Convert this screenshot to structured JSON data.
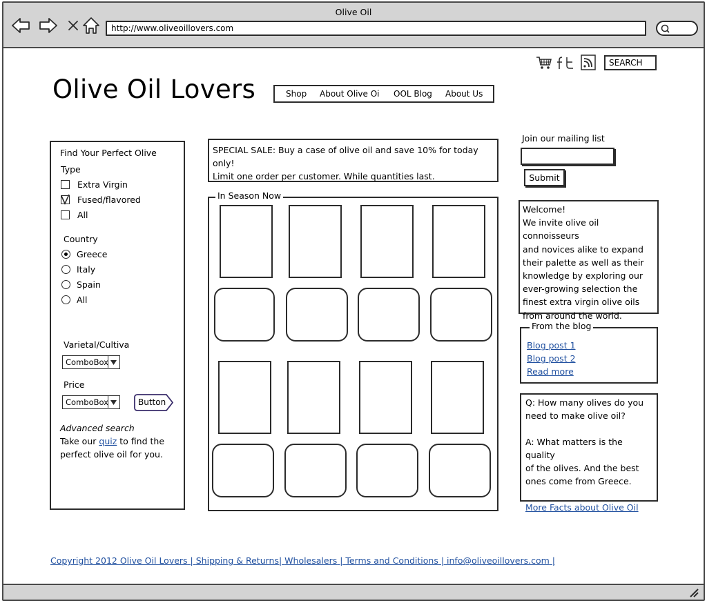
{
  "browser": {
    "window_title": "Olive Oil",
    "url": "http://www.oliveoillovers.com",
    "icons": [
      "back-arrow-icon",
      "forward-arrow-icon",
      "close-x-icon",
      "home-icon",
      "search-icon",
      "resize-grip-icon"
    ]
  },
  "header": {
    "site_title": "Olive Oil Lovers",
    "nav": [
      "Shop",
      "About Olive Oi",
      "OOL Blog",
      "About Us"
    ],
    "search_label": "SEARCH",
    "social_icons": [
      "cart-icon",
      "facebook-icon",
      "twitter-icon",
      "rss-icon"
    ]
  },
  "filters": {
    "title": "Find Your Perfect Olive",
    "type_label": "Type",
    "type_options": [
      {
        "label": "Extra Virgin",
        "checked": false
      },
      {
        "label": "Fused/flavored",
        "checked": true
      },
      {
        "label": "All",
        "checked": false
      }
    ],
    "country_label": "Country",
    "country_options": [
      {
        "label": "Greece",
        "selected": true
      },
      {
        "label": "Italy",
        "selected": false
      },
      {
        "label": "Spain",
        "selected": false
      },
      {
        "label": "All",
        "selected": false
      }
    ],
    "varietal_label": "Varietal/Cultiva",
    "varietal_combo": "ComboBox",
    "price_label": "Price",
    "price_combo": "ComboBox",
    "button_label": "Button",
    "advanced_title": "Advanced search",
    "advanced_prefix": "Take our",
    "advanced_link": "quiz",
    "advanced_suffix": "to find the",
    "advanced_line2": "perfect olive oil for you."
  },
  "sale": {
    "line1": "SPECIAL SALE: Buy a case of olive oil and save 10% for today only!",
    "line2": "Limit one order per customer. While quantities last."
  },
  "season": {
    "legend": "In Season Now"
  },
  "mailing": {
    "label": "Join our mailing list",
    "input_value": "",
    "submit_label": "Submit"
  },
  "welcome": {
    "lines": [
      "Welcome!",
      "We invite olive oil connoisseurs",
      "and novices alike to expand",
      "their palette as well as their",
      "knowledge by exploring our",
      "ever-growing selection the",
      "finest extra virgin olive oils",
      "from around the world."
    ]
  },
  "blog": {
    "legend": "From the blog",
    "links": [
      "Blog post 1",
      "Blog post 2",
      "Read more"
    ]
  },
  "faq": {
    "q_line1": "Q: How many olives do you",
    "q_line2": "need to make olive oil?",
    "a_line1": "A: What matters is the quality",
    "a_line2": "of the olives. And the best",
    "a_line3": "ones come from Greece.",
    "more_link": "More Facts about Olive Oil"
  },
  "footer": {
    "links": [
      "Copyright 2012 Olive Oil Lovers",
      "Shipping & Returns",
      "Wholesalers",
      "Terms and Conditions",
      "info@oliveoillovers.com"
    ]
  }
}
